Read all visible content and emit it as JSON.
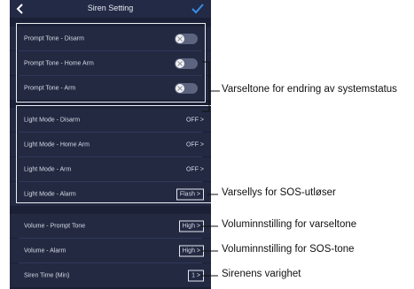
{
  "header": {
    "title": "Siren Setting"
  },
  "prompt_tones": [
    {
      "label": "Prompt Tone - Disarm",
      "enabled": false
    },
    {
      "label": "Prompt Tone - Home Arm",
      "enabled": false
    },
    {
      "label": "Prompt Tone - Arm",
      "enabled": false
    }
  ],
  "light_modes": [
    {
      "label": "Light Mode - Disarm",
      "value": "OFF >"
    },
    {
      "label": "Light Mode - Home Arm",
      "value": "OFF >"
    },
    {
      "label": "Light Mode - Arm",
      "value": "OFF >"
    },
    {
      "label": "Light Mode - Alarm",
      "value": "Flash >"
    }
  ],
  "volume": [
    {
      "label": "Volume - Prompt Tone",
      "value": "High >"
    },
    {
      "label": "Volume - Alarm",
      "value": "High >"
    }
  ],
  "siren_time": {
    "label": "Siren Time (Min)",
    "value": "1 >"
  },
  "annotations": {
    "prompt_tone": "Varseltone for endring av systemstatus",
    "alarm_light": "Varsellys for SOS-utløser",
    "volume_prompt": "Voluminnstilling for varseltone",
    "volume_alarm": "Voluminnstilling for SOS-tone",
    "siren_time": "Sirenens varighet"
  },
  "colors": {
    "background": "#1b2036",
    "row": "#222941",
    "accent": "#3a8ee6"
  },
  "icons": {
    "back": "chevron-left-icon",
    "confirm": "check-icon",
    "toggle_off": "x-icon"
  }
}
